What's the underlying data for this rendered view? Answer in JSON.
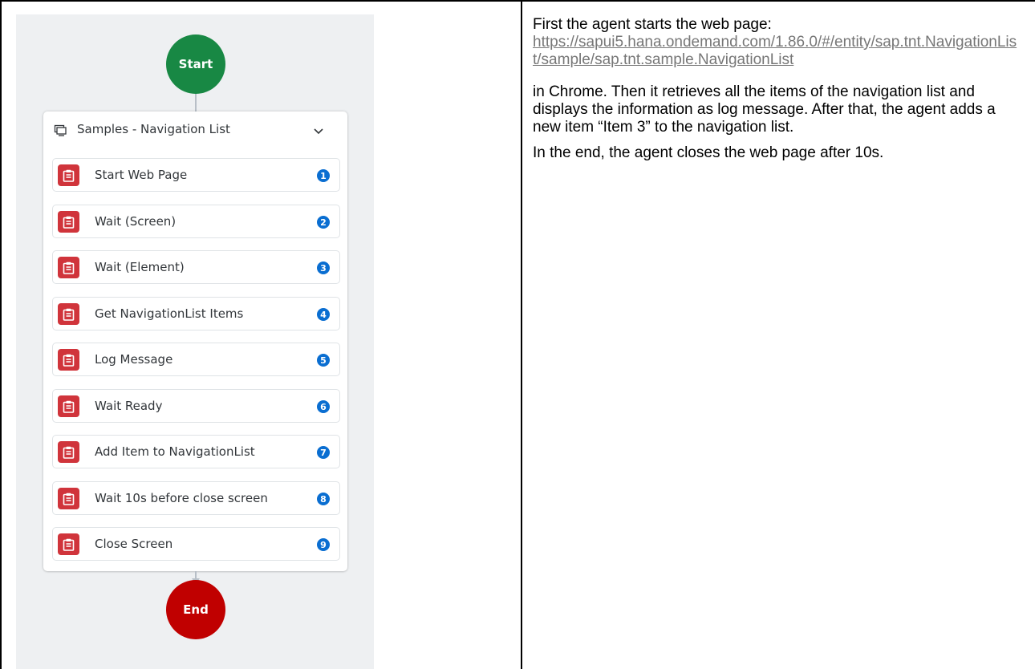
{
  "flow": {
    "start_label": "Start",
    "end_label": "End",
    "group": {
      "title": "Samples - Navigation List",
      "icon": "screen-icon",
      "toggle_icon": "chevron-down-icon"
    },
    "steps": [
      {
        "label": "Start Web Page",
        "number": "1"
      },
      {
        "label": "Wait (Screen)",
        "number": "2"
      },
      {
        "label": "Wait (Element)",
        "number": "3"
      },
      {
        "label": "Get NavigationList Items",
        "number": "4"
      },
      {
        "label": "Log Message",
        "number": "5"
      },
      {
        "label": "Wait Ready",
        "number": "6"
      },
      {
        "label": "Add Item to NavigationList",
        "number": "7"
      },
      {
        "label": "Wait 10s before close screen",
        "number": "8"
      },
      {
        "label": "Close Screen",
        "number": "9"
      }
    ],
    "step_icon": "clipboard-icon",
    "colors": {
      "start": "#188844",
      "end": "#c00000",
      "step_icon_bg": "#d0343b",
      "step_number_bg": "#0a6ed1",
      "canvas_bg": "#eef0f2"
    }
  },
  "description": {
    "intro": "First the agent starts the web page:",
    "url": "https://sapui5.hana.ondemand.com/1.86.0/#/entity/sap.tnt.NavigationList/sample/sap.tnt.sample.NavigationList",
    "paragraph2": "in Chrome. Then it retrieves all the items of the navigation list and displays the information as log message. After that, the agent adds a new item “Item 3” to the navigation list.",
    "paragraph3": "In the end, the agent closes the web page after 10s."
  }
}
